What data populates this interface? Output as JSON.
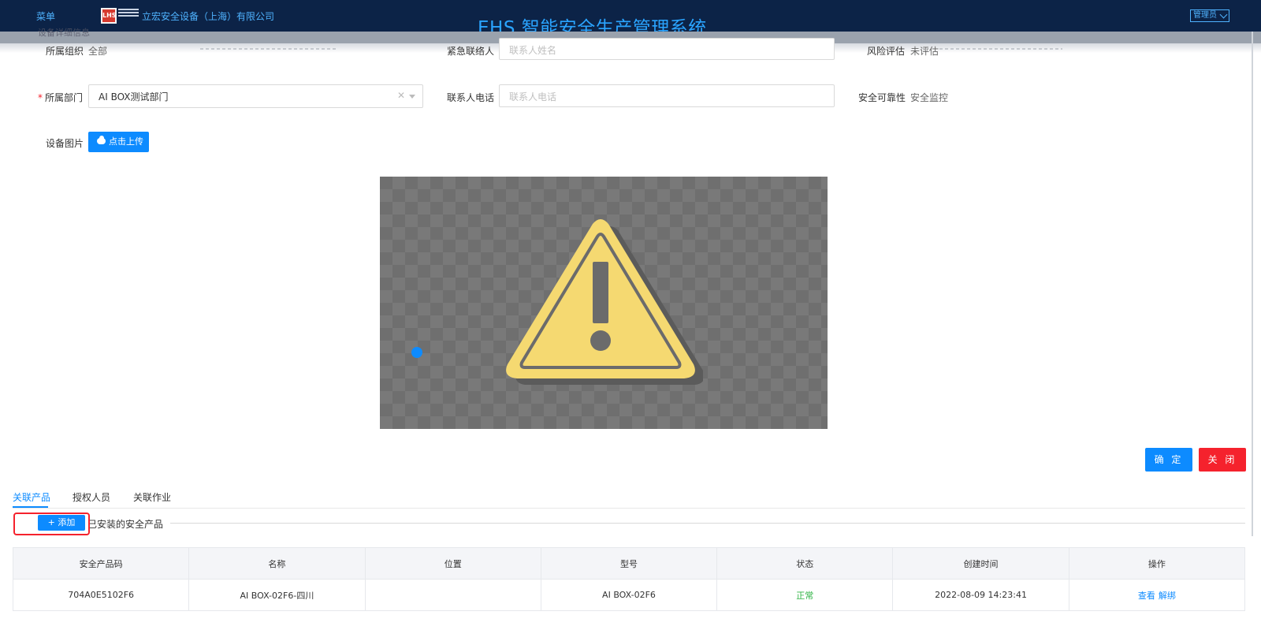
{
  "header": {
    "menu_label": "菜单",
    "logo_text": "LHS",
    "company_name": "立宏安全设备（上海）有限公司",
    "system_title": "EHS 智能安全生产管理系统",
    "admin_label": "管理员"
  },
  "section_peek": "设备详细信息",
  "form": {
    "org_label": "所属组织",
    "org_value": "全部",
    "emergency_contact_label": "紧急联络人",
    "emergency_contact_placeholder": "联系人姓名",
    "risk_label": "风险评估",
    "risk_value": "未评估",
    "dept_label": "所属部门",
    "dept_value": "AI BOX测试部门",
    "contact_phone_label": "联系人电话",
    "contact_phone_placeholder": "联系人电话",
    "reliability_label": "安全可靠性",
    "reliability_value": "安全监控",
    "image_label": "设备图片",
    "upload_label": "点击上传"
  },
  "actions": {
    "confirm_label": "确 定",
    "close_label": "关 闭"
  },
  "tabs": [
    {
      "label": "关联产品",
      "active": true
    },
    {
      "label": "授权人员",
      "active": false
    },
    {
      "label": "关联作业",
      "active": false
    }
  ],
  "products_section": {
    "title": "已安装的安全产品",
    "add_label": "+ 添加"
  },
  "table": {
    "columns": [
      "安全产品码",
      "名称",
      "位置",
      "型号",
      "状态",
      "创建时间",
      "操作"
    ],
    "rows": [
      {
        "code": "704A0E5102F6",
        "name": "AI BOX-02F6-四川",
        "location": "",
        "model": "AI BOX-02F6",
        "status": "正常",
        "created": "2022-08-09 14:23:41",
        "op_view": "查看",
        "op_unbind": "解绑"
      }
    ]
  },
  "colors": {
    "header_bg": "#0c2347",
    "accent": "#0d8bff",
    "danger": "#f5222d",
    "status_ok": "#2fb344"
  }
}
